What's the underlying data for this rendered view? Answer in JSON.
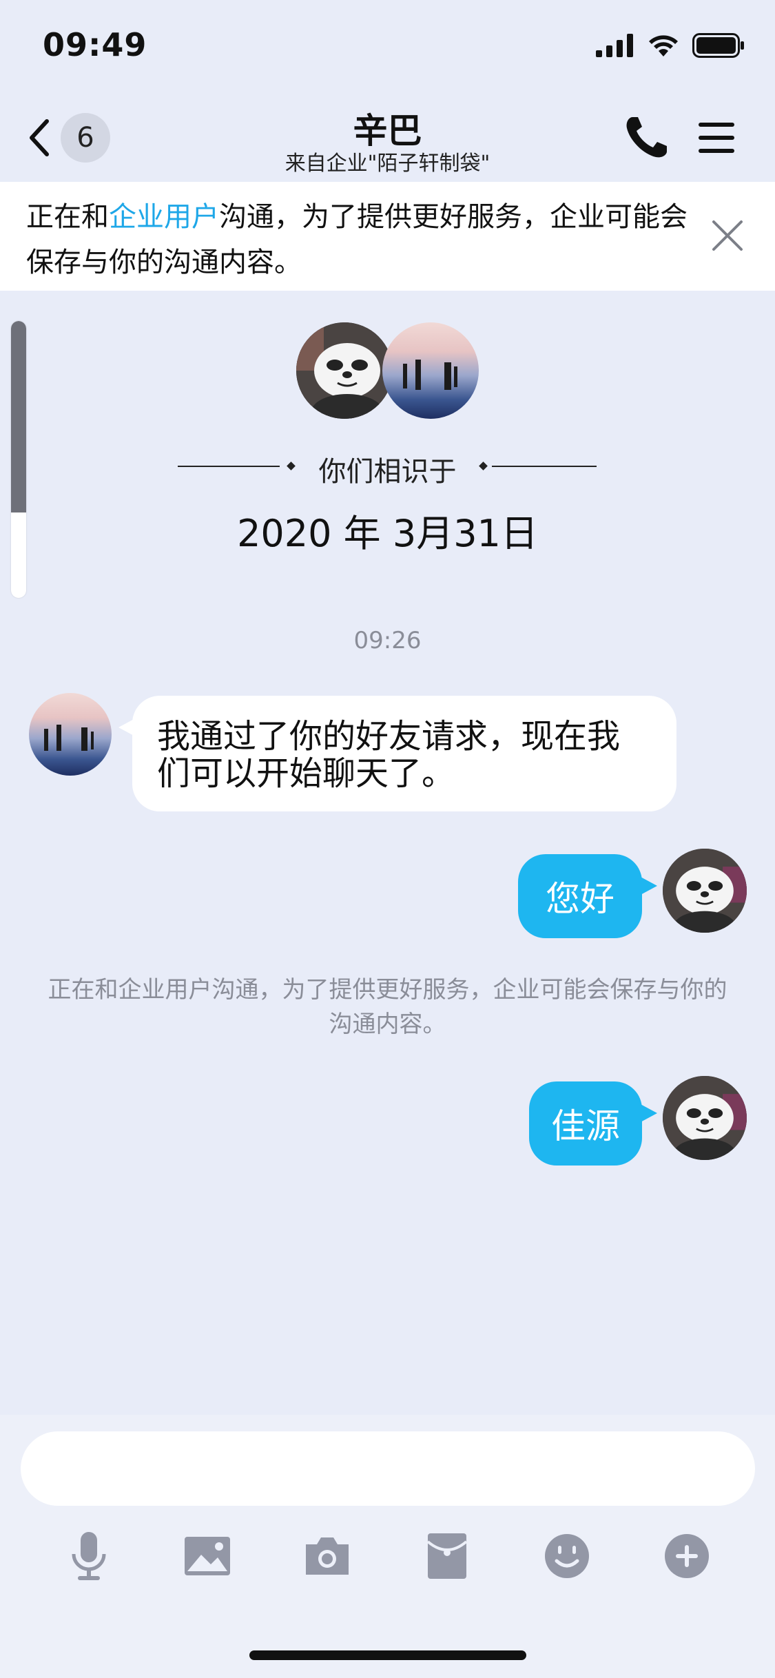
{
  "status_bar": {
    "time": "09:49"
  },
  "header": {
    "back_count": "6",
    "title": "辛巴",
    "subtitle": "来自企业\"陌子轩制袋\""
  },
  "banner": {
    "prefix": "正在和",
    "highlight": "企业用户",
    "suffix": "沟通，为了提供更好服务，企业可能会保存与你的沟通内容。",
    "highlight_color": "#1ea7e8"
  },
  "intro": {
    "met_label": "你们相识于",
    "met_date": "2020 年 3月31日"
  },
  "messages": {
    "timestamp": "09:26",
    "incoming_1": "我通过了你的好友请求，现在我们可以开始聊天了。",
    "outgoing_1": "您好",
    "system_note": "正在和企业用户沟通，为了提供更好服务，企业可能会保存与你的沟通内容。",
    "outgoing_2": "佳源"
  },
  "toolbar": {
    "icons": [
      "microphone-icon",
      "image-icon",
      "camera-icon",
      "red-packet-icon",
      "emoji-icon",
      "plus-icon"
    ]
  },
  "colors": {
    "accent": "#1eb6f0",
    "background": "#e8ecf8",
    "icon_gray": "#9397a6"
  }
}
